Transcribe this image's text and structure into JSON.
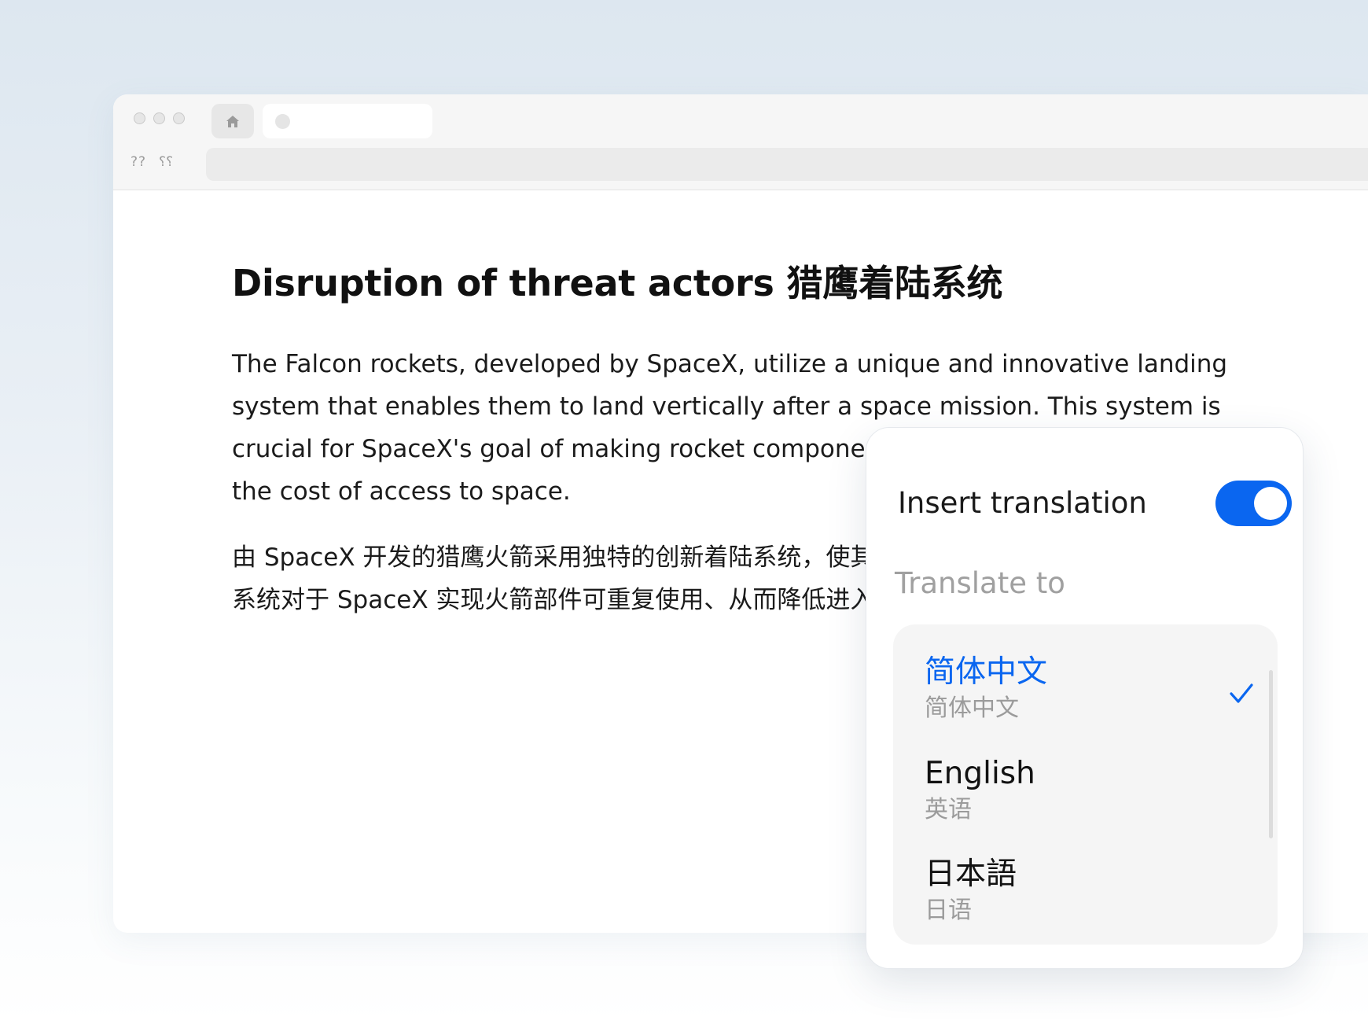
{
  "browser": {
    "nav_back_glyph": "??",
    "nav_forward_glyph": "؟؟"
  },
  "article": {
    "title": "Disruption of threat actors 猎鹰着陆系统",
    "paragraph_en": "The Falcon rockets, developed by SpaceX, utilize a unique and innovative landing system that enables them to land vertically after a space mission. This system is crucial for SpaceX's goal of making rocket components reusable, thereby reducing the cost of access to space.",
    "paragraph_zh": "由 SpaceX 开发的猎鹰火箭采用独特的创新着陆系统，使其能够在完成太空任务后垂直着陆。该系统对于 SpaceX 实现火箭部件可重复使用、从而降低进入太空的成本至关重要。"
  },
  "popup": {
    "insert_label": "Insert translation",
    "insert_enabled": true,
    "translate_to_label": "Translate to",
    "languages": [
      {
        "name": "简体中文",
        "sub": "简体中文",
        "selected": true
      },
      {
        "name": "English",
        "sub": "英语",
        "selected": false
      },
      {
        "name": "日本語",
        "sub": "日语",
        "selected": false
      }
    ]
  },
  "colors": {
    "accent": "#0a66f0",
    "text_primary": "#1b1b1b",
    "text_secondary": "#9b9b9b"
  }
}
